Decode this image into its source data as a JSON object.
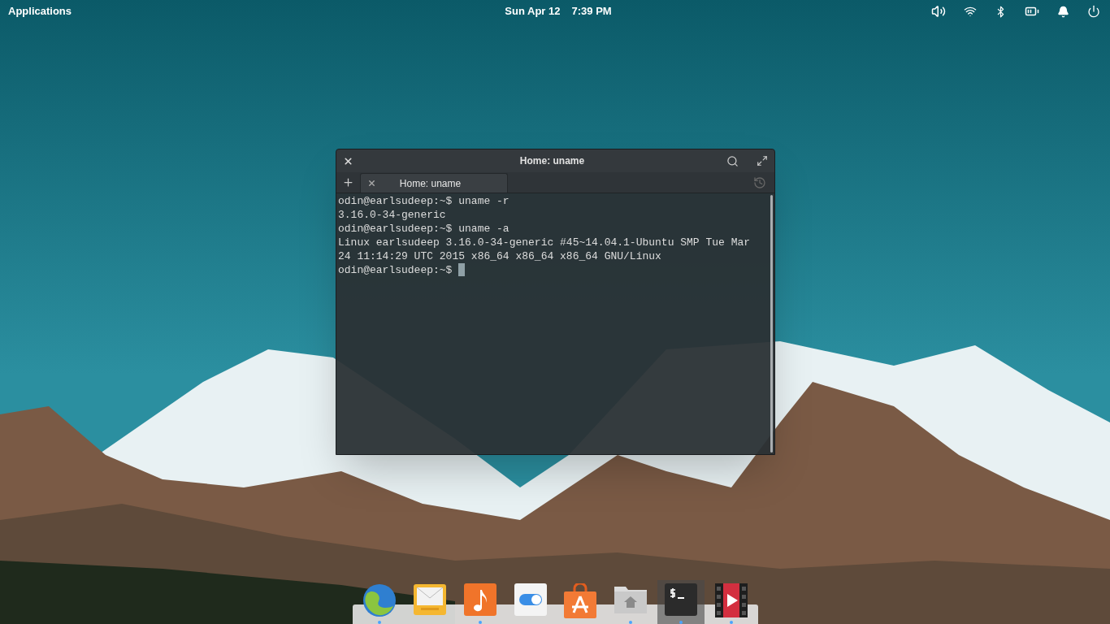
{
  "top_panel": {
    "applications": "Applications",
    "date": "Sun Apr 12",
    "time": "7:39 PM"
  },
  "window": {
    "title": "Home: uname",
    "tabs": [
      {
        "label": "Home: uname",
        "selected": true
      }
    ],
    "lines": [
      "odin@earlsudeep:~$ uname -r",
      "3.16.0-34-generic",
      "odin@earlsudeep:~$ uname -a",
      "Linux earlsudeep 3.16.0-34-generic #45~14.04.1-Ubuntu SMP Tue Mar",
      "24 11:14:29 UTC 2015 x86_64 x86_64 x86_64 GNU/Linux"
    ],
    "prompt": "odin@earlsudeep:~$ "
  },
  "dock": [
    {
      "kind": "browser",
      "running": true,
      "selected": false
    },
    {
      "kind": "mail",
      "running": false,
      "selected": false
    },
    {
      "kind": "music",
      "running": true,
      "selected": false
    },
    {
      "kind": "settings",
      "running": false,
      "selected": false
    },
    {
      "kind": "store",
      "running": false,
      "selected": false
    },
    {
      "kind": "files",
      "running": true,
      "selected": false
    },
    {
      "kind": "terminal",
      "running": true,
      "selected": true
    },
    {
      "kind": "video",
      "running": true,
      "selected": false
    }
  ]
}
